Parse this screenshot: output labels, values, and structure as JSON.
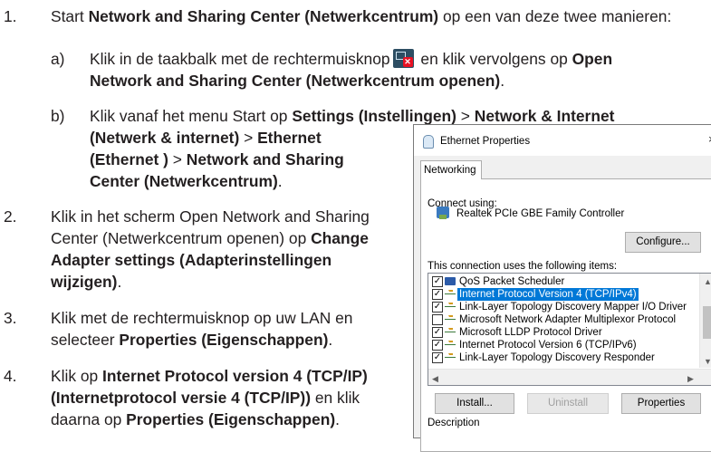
{
  "steps": [
    {
      "num": "1.",
      "text_a": "Start ",
      "bold_a": "Network and Sharing Center (Netwerkcentrum)",
      "text_b": " op een van deze twee manieren:"
    },
    {
      "num": "2.",
      "line1": "Klik in het scherm Open Network and Sharing",
      "line2_a": "Center (Netwerkcentrum openen) op ",
      "line2_b": "Change",
      "line3": "Adapter settings (Adapterinstellingen",
      "line4": "wijzigen)",
      "line4_end": "."
    },
    {
      "num": "3.",
      "line1": "Klik met de rechtermuisknop op uw LAN en",
      "line2_a": "selecteer ",
      "line2_b": "Properties (Eigenschappen)",
      "line2_c": "."
    },
    {
      "num": "4.",
      "line1_a": "Klik op ",
      "line1_b": "Internet Protocol version 4 (TCP/IP)",
      "line2_a": "(Internetprotocol versie 4 (TCP/IP))",
      "line2_b": " en klik",
      "line3_a": "daarna op ",
      "line3_b": "Properties (Eigenschappen)",
      "line3_c": "."
    }
  ],
  "sub_a": {
    "label": "a)",
    "text_a": "Klik in de taakbalk met de rechtermuisknop",
    "text_b": " en klik vervolgens op ",
    "bold_b": "Open",
    "line2_bold": "Network and Sharing Center (Netwerkcentrum openen)",
    "line2_end": "."
  },
  "sub_b": {
    "label": "b)",
    "text_a": "Klik vanaf het menu Start op ",
    "bold_a": "Settings (Instellingen)",
    "sep1": " > ",
    "bold_b": "Network & Internet",
    "line2": "(Netwerk & internet)",
    "line2_sep": " > ",
    "line2_b": "Ethernet",
    "line3": "(Ethernet )",
    "line3_sep": " > ",
    "line3_b": "Network and Sharing",
    "line4": "Center (Netwerkcentrum)",
    "line4_end": "."
  },
  "dialog": {
    "title": "Ethernet Properties",
    "close": "×",
    "tab": "Networking",
    "connect_using": "Connect using:",
    "adapter": "Realtek PCIe GBE Family Controller",
    "configure": "Configure...",
    "items_label": "This connection uses the following items:",
    "items": [
      {
        "checked": true,
        "label": "QoS Packet Scheduler"
      },
      {
        "checked": true,
        "label": "Internet Protocol Version 4 (TCP/IPv4)",
        "selected": true
      },
      {
        "checked": true,
        "label": "Link-Layer Topology Discovery Mapper I/O Driver"
      },
      {
        "checked": false,
        "label": "Microsoft Network Adapter Multiplexor Protocol"
      },
      {
        "checked": true,
        "label": "Microsoft LLDP Protocol Driver"
      },
      {
        "checked": true,
        "label": "Internet Protocol Version 6 (TCP/IPv6)"
      },
      {
        "checked": true,
        "label": "Link-Layer Topology Discovery Responder"
      }
    ],
    "install": "Install...",
    "uninstall": "Uninstall",
    "properties": "Properties",
    "description": "Description"
  }
}
